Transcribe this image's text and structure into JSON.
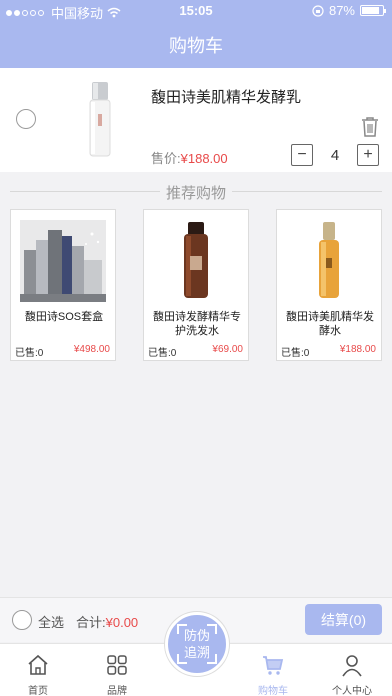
{
  "status_bar": {
    "carrier": "中国移动",
    "time": "15:05",
    "battery": "87%"
  },
  "header": {
    "title": "购物车"
  },
  "cart_item": {
    "name": "馥田诗美肌精华发酵乳",
    "price_label": "售价:",
    "price": "¥188.00",
    "quantity": "4",
    "minus": "−",
    "plus": "+"
  },
  "recommend": {
    "title": "推荐购物",
    "products": [
      {
        "name": "馥田诗SOS套盒",
        "sold": "已售:0",
        "price": "¥498.00"
      },
      {
        "name": "馥田诗发酵精华专护洗发水",
        "sold": "已售:0",
        "price": "¥69.00"
      },
      {
        "name": "馥田诗美肌精华发酵水",
        "sold": "已售:0",
        "price": "¥188.00"
      }
    ]
  },
  "checkout": {
    "select_all": "全选",
    "total_label": "合计:",
    "total_value": "¥0.00",
    "settle_button": "结算(0)"
  },
  "tabbar": {
    "items": [
      {
        "label": "首页",
        "icon": "home-icon"
      },
      {
        "label": "品牌",
        "icon": "grid-icon"
      },
      {
        "label": "购物车",
        "icon": "cart-icon"
      },
      {
        "label": "个人中心",
        "icon": "person-icon"
      }
    ],
    "center_button": {
      "line1": "防伪",
      "line2": "追溯"
    }
  },
  "colors": {
    "accent": "#a9b8ef",
    "price": "#e84a4a"
  }
}
